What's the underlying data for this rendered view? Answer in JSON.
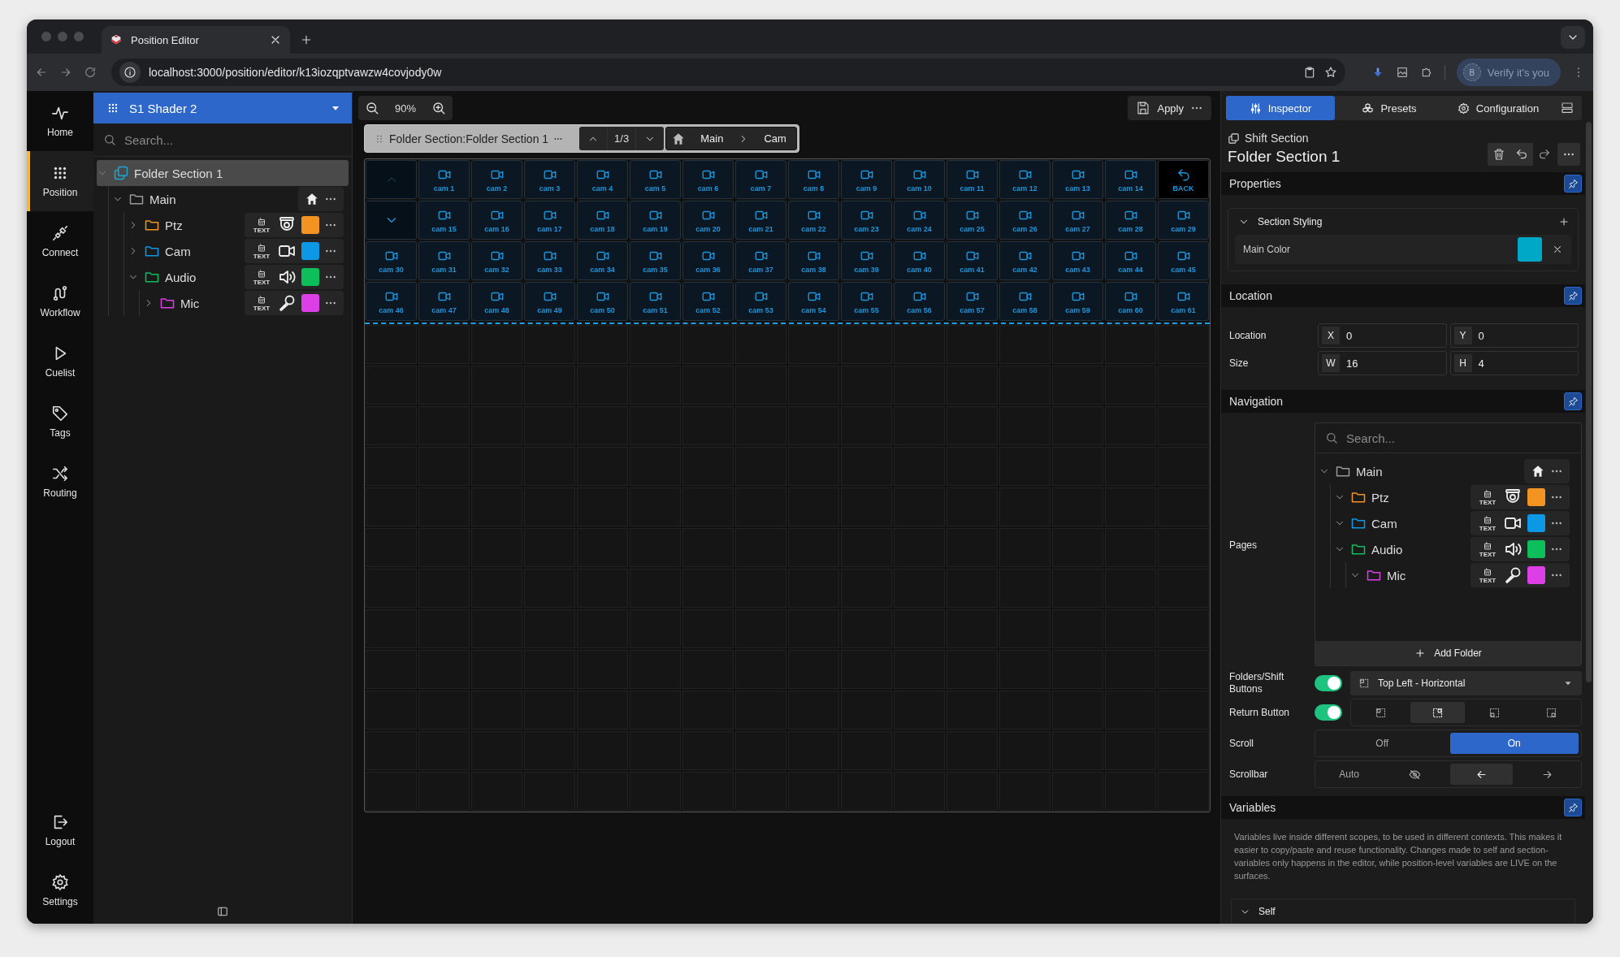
{
  "browser": {
    "tab_title": "Position Editor",
    "url": "localhost:3000/position/editor/k13iozqptvawzw4covjody0w",
    "profile_initial": "B",
    "profile_button": "Verify it's you"
  },
  "nav_rail": {
    "items": [
      {
        "kind": "home",
        "label": "Home",
        "selected": false
      },
      {
        "kind": "position",
        "label": "Position",
        "selected": true
      },
      {
        "kind": "connect",
        "label": "Connect",
        "selected": false
      },
      {
        "kind": "workflow",
        "label": "Workflow",
        "selected": false
      },
      {
        "kind": "cuelist",
        "label": "Cuelist",
        "selected": false
      },
      {
        "kind": "tags",
        "label": "Tags",
        "selected": false
      },
      {
        "kind": "routing",
        "label": "Routing",
        "selected": false
      }
    ],
    "bottom_items": [
      {
        "kind": "logout",
        "label": "Logout",
        "selected": false
      },
      {
        "kind": "settings",
        "label": "Settings",
        "selected": false
      }
    ]
  },
  "tree_panel": {
    "shader": "S1 Shader 2",
    "search": {
      "placeholder": "Search..."
    },
    "tree": [
      {
        "kind": "section",
        "label": "Folder Section 1",
        "selected": true,
        "expanded": true,
        "children": [
          {
            "kind": "root",
            "label": "Main",
            "selected": false,
            "expanded": true,
            "children": [
              {
                "kind": "ptz",
                "label": "Ptz",
                "badge": "TEXT",
                "color": "#f39322",
                "selected": false,
                "expanded": false
              },
              {
                "kind": "camera",
                "label": "Cam",
                "badge": "TEXT",
                "color": "#0d98e6",
                "selected": false,
                "expanded": false
              },
              {
                "kind": "audio",
                "label": "Audio",
                "badge": "TEXT",
                "color": "#0cbf5a",
                "selected": false,
                "expanded": true,
                "children": [
                  {
                    "kind": "mic",
                    "label": "Mic",
                    "badge": "TEXT",
                    "color": "#dd3fe6",
                    "selected": false,
                    "expanded": false
                  }
                ]
              }
            ]
          }
        ]
      }
    ]
  },
  "canvas": {
    "zoom": "90%",
    "apply_button": "Apply",
    "section_toolbar": {
      "label": "Folder Section:Folder Section 1",
      "page": "1/3",
      "path": [
        "Main",
        "Cam"
      ]
    },
    "grid": {
      "rows": [
        [
          {
            "kind": "page_up",
            "disabled": true
          },
          {
            "kind": "camera",
            "label": "cam 1"
          },
          {
            "kind": "camera",
            "label": "cam 2"
          },
          {
            "kind": "camera",
            "label": "cam 3"
          },
          {
            "kind": "camera",
            "label": "cam 4"
          },
          {
            "kind": "camera",
            "label": "cam 5"
          },
          {
            "kind": "camera",
            "label": "cam 6"
          },
          {
            "kind": "camera",
            "label": "cam 7"
          },
          {
            "kind": "camera",
            "label": "cam 8"
          },
          {
            "kind": "camera",
            "label": "cam 9"
          },
          {
            "kind": "camera",
            "label": "cam 10"
          },
          {
            "kind": "camera",
            "label": "cam 11"
          },
          {
            "kind": "camera",
            "label": "cam 12"
          },
          {
            "kind": "camera",
            "label": "cam 13"
          },
          {
            "kind": "camera",
            "label": "cam 14"
          },
          {
            "kind": "back",
            "label": "BACK"
          }
        ],
        [
          {
            "kind": "page_down",
            "disabled": false
          },
          {
            "kind": "camera",
            "label": "cam 15"
          },
          {
            "kind": "camera",
            "label": "cam 16"
          },
          {
            "kind": "camera",
            "label": "cam 17"
          },
          {
            "kind": "camera",
            "label": "cam 18"
          },
          {
            "kind": "camera",
            "label": "cam 19"
          },
          {
            "kind": "camera",
            "label": "cam 20"
          },
          {
            "kind": "camera",
            "label": "cam 21"
          },
          {
            "kind": "camera",
            "label": "cam 22"
          },
          {
            "kind": "camera",
            "label": "cam 23"
          },
          {
            "kind": "camera",
            "label": "cam 24"
          },
          {
            "kind": "camera",
            "label": "cam 25"
          },
          {
            "kind": "camera",
            "label": "cam 26"
          },
          {
            "kind": "camera",
            "label": "cam 27"
          },
          {
            "kind": "camera",
            "label": "cam 28"
          },
          {
            "kind": "camera",
            "label": "cam 29"
          }
        ],
        [
          {
            "kind": "camera",
            "label": "cam 30"
          },
          {
            "kind": "camera",
            "label": "cam 31"
          },
          {
            "kind": "camera",
            "label": "cam 32"
          },
          {
            "kind": "camera",
            "label": "cam 33"
          },
          {
            "kind": "camera",
            "label": "cam 34"
          },
          {
            "kind": "camera",
            "label": "cam 35"
          },
          {
            "kind": "camera",
            "label": "cam 36"
          },
          {
            "kind": "camera",
            "label": "cam 37"
          },
          {
            "kind": "camera",
            "label": "cam 38"
          },
          {
            "kind": "camera",
            "label": "cam 39"
          },
          {
            "kind": "camera",
            "label": "cam 40"
          },
          {
            "kind": "camera",
            "label": "cam 41"
          },
          {
            "kind": "camera",
            "label": "cam 42"
          },
          {
            "kind": "camera",
            "label": "cam 43"
          },
          {
            "kind": "camera",
            "label": "cam 44"
          },
          {
            "kind": "camera",
            "label": "cam 45"
          }
        ],
        [
          {
            "kind": "camera",
            "label": "cam 46"
          },
          {
            "kind": "camera",
            "label": "cam 47"
          },
          {
            "kind": "camera",
            "label": "cam 48"
          },
          {
            "kind": "camera",
            "label": "cam 49"
          },
          {
            "kind": "camera",
            "label": "cam 50"
          },
          {
            "kind": "camera",
            "label": "cam 51"
          },
          {
            "kind": "camera",
            "label": "cam 52"
          },
          {
            "kind": "camera",
            "label": "cam 53"
          },
          {
            "kind": "camera",
            "label": "cam 54"
          },
          {
            "kind": "camera",
            "label": "cam 55"
          },
          {
            "kind": "camera",
            "label": "cam 56"
          },
          {
            "kind": "camera",
            "label": "cam 57"
          },
          {
            "kind": "camera",
            "label": "cam 58"
          },
          {
            "kind": "camera",
            "label": "cam 59"
          },
          {
            "kind": "camera",
            "label": "cam 60"
          },
          {
            "kind": "camera",
            "label": "cam 61"
          }
        ]
      ]
    }
  },
  "inspector": {
    "tabs": [
      {
        "kind": "inspector",
        "label": "Inspector",
        "selected": true
      },
      {
        "kind": "presets",
        "label": "Presets",
        "selected": false
      },
      {
        "kind": "configuration",
        "label": "Configuration",
        "selected": false
      }
    ],
    "type_label": "Shift Section",
    "title": "Folder Section 1",
    "properties": {
      "title": "Properties",
      "group": {
        "title": "Section Styling",
        "expanded": true,
        "fields": [
          {
            "label": "Main Color",
            "color": "#00a8c8"
          }
        ]
      }
    },
    "location": {
      "title": "Location",
      "rows": [
        {
          "label": "Location",
          "fields": [
            {
              "prefix": "X",
              "value": "0"
            },
            {
              "prefix": "Y",
              "value": "0"
            }
          ]
        },
        {
          "label": "Size",
          "fields": [
            {
              "prefix": "W",
              "value": "16"
            },
            {
              "prefix": "H",
              "value": "4"
            }
          ]
        }
      ]
    },
    "navigation": {
      "title": "Navigation",
      "pages_label": "Pages",
      "search": {
        "placeholder": "Search..."
      },
      "tree": [
        {
          "kind": "root",
          "label": "Main",
          "expanded": true,
          "children": [
            {
              "kind": "ptz",
              "label": "Ptz",
              "badge": "TEXT",
              "color": "#f39322",
              "expanded": true
            },
            {
              "kind": "camera",
              "label": "Cam",
              "badge": "TEXT",
              "color": "#0d98e6",
              "expanded": true
            },
            {
              "kind": "audio",
              "label": "Audio",
              "badge": "TEXT",
              "color": "#0cbf5a",
              "expanded": true,
              "children": [
                {
                  "kind": "mic",
                  "label": "Mic",
                  "badge": "TEXT",
                  "color": "#dd3fe6",
                  "expanded": true
                }
              ]
            }
          ]
        }
      ],
      "add_folder": "Add Folder",
      "folders_shift": {
        "label": "Folders/Shift Buttons",
        "on": true,
        "dropdown": "Top Left - Horizontal"
      },
      "return_button": {
        "label": "Return Button",
        "on": true,
        "positions": [
          {
            "kind": "top_left",
            "selected": false
          },
          {
            "kind": "top_right",
            "selected": true
          },
          {
            "kind": "bottom_left",
            "selected": false
          },
          {
            "kind": "bottom_right",
            "selected": false
          }
        ]
      },
      "scroll": {
        "label": "Scroll",
        "options": [
          {
            "kind": "text",
            "label": "Off",
            "selected": false
          },
          {
            "kind": "text",
            "label": "On",
            "selected": true
          }
        ]
      },
      "scrollbar": {
        "label": "Scrollbar",
        "options": [
          {
            "kind": "text",
            "label": "Auto",
            "selected": false
          },
          {
            "kind": "hidden",
            "selected": false
          },
          {
            "kind": "left",
            "selected": true
          },
          {
            "kind": "right",
            "selected": false
          }
        ]
      }
    },
    "variables": {
      "title": "Variables",
      "description": "Variables live inside different scopes, to be used in different contexts. This makes it easier to copy/paste and reuse functionality. Changes made to self and section-variables only happens in the editor, while position-level variables are LIVE on the surfaces.",
      "groups": [
        {
          "label": "Self",
          "expanded": true
        }
      ]
    }
  }
}
